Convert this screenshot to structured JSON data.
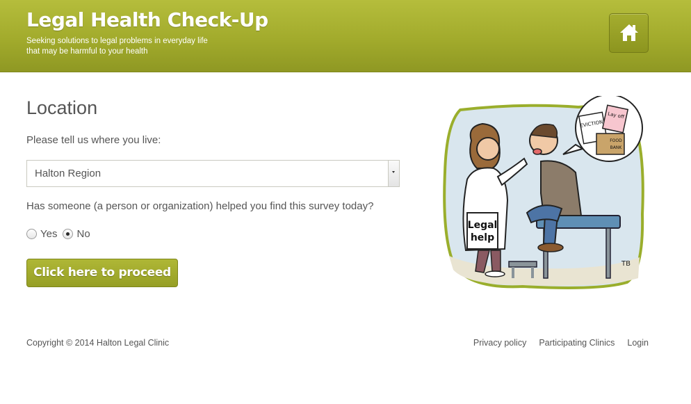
{
  "header": {
    "title": "Legal Health Check-Up",
    "tagline_line1": "Seeking solutions to legal problems in everyday life",
    "tagline_line2": "that may be harmful to your health",
    "home_icon": "home-icon"
  },
  "main": {
    "heading": "Location",
    "prompt": "Please tell us where you live:",
    "region_select": {
      "selected": "Halton Region"
    },
    "question": "Has someone (a person or organization) helped you find this survey today?",
    "radio_options": [
      {
        "label": "Yes",
        "checked": false
      },
      {
        "label": "No",
        "checked": true
      }
    ],
    "proceed_label": "Click here to proceed"
  },
  "illustration": {
    "badge_line1": "Legal",
    "badge_line2": "help",
    "bubble_eviction": "EVICTION",
    "bubble_layoff": "Lay off",
    "bubble_food": "FOOD",
    "bubble_bank": "BANK",
    "signature": "TB"
  },
  "footer": {
    "copyright": "Copyright © 2014 Halton Legal Clinic",
    "links": [
      "Privacy policy",
      "Participating Clinics",
      "Login"
    ]
  },
  "colors": {
    "header_green": "#a2ab2c",
    "button_green": "#a3ab2f",
    "text_gray": "#555555"
  }
}
